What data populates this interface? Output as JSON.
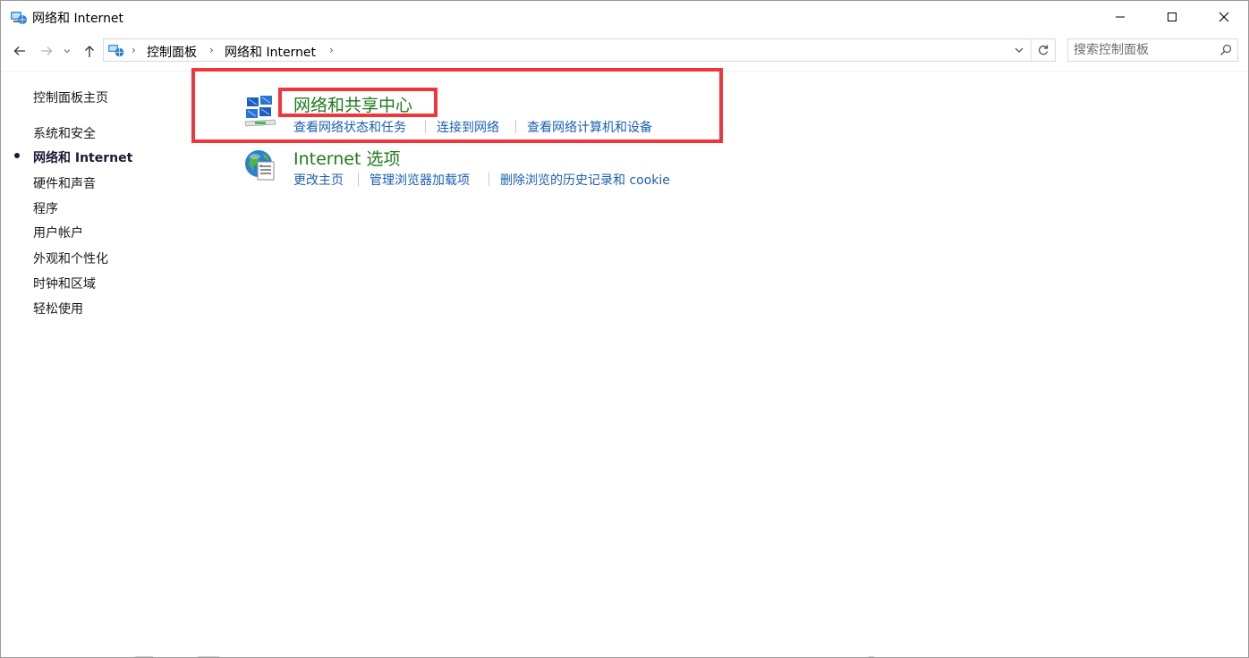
{
  "window": {
    "title": "网络和 Internet",
    "icon": "network-globe-icon",
    "controls": [
      "minimize-icon",
      "maximize-icon",
      "close-icon"
    ]
  },
  "address": {
    "breadcrumbs": [
      "控制面板",
      "网络和 Internet"
    ],
    "search_placeholder": "搜索控制面板"
  },
  "sidebar": {
    "items": [
      {
        "label": "控制面板主页",
        "current": false
      },
      {
        "label": "系统和安全",
        "current": false
      },
      {
        "label": "网络和 Internet",
        "current": true
      },
      {
        "label": "硬件和声音",
        "current": false
      },
      {
        "label": "程序",
        "current": false
      },
      {
        "label": "用户帐户",
        "current": false
      },
      {
        "label": "外观和个性化",
        "current": false
      },
      {
        "label": "时钟和区域",
        "current": false
      },
      {
        "label": "轻松使用",
        "current": false
      }
    ]
  },
  "categories": [
    {
      "title": "网络和共享中心",
      "icon": "network-sharing-center-icon",
      "links": [
        "查看网络状态和任务",
        "连接到网络",
        "查看网络计算机和设备"
      ]
    },
    {
      "title": "Internet 选项",
      "icon": "internet-options-icon",
      "links": [
        "更改主页",
        "管理浏览器加载项",
        "删除浏览的历史记录和 cookie"
      ]
    }
  ],
  "colors": {
    "category_title": "#1e7a1e",
    "link": "#1a5fb4",
    "highlight": "#f0363c"
  }
}
